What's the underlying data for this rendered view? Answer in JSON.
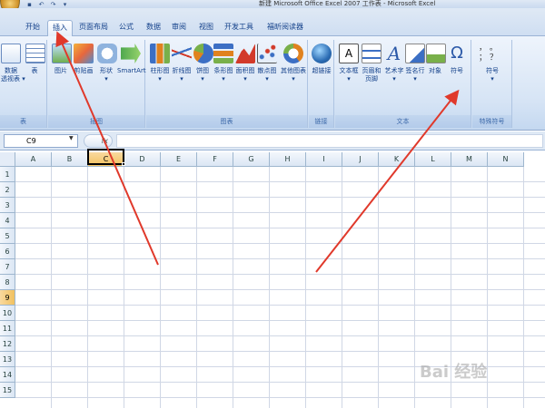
{
  "window": {
    "title": "新建 Microsoft Office Excel 2007 工作表 - Microsoft Excel"
  },
  "tabs": [
    "开始",
    "插入",
    "页面布局",
    "公式",
    "数据",
    "审阅",
    "视图",
    "开发工具",
    "福昕阅读器"
  ],
  "active_tab": "插入",
  "ribbon": {
    "groups": {
      "table": {
        "label": "表",
        "buttons": {
          "pivot": "数据\n透视表 ▾",
          "table": "表"
        }
      },
      "illustrations": {
        "label": "插图",
        "buttons": {
          "picture": "图片",
          "clipart": "剪贴画",
          "shapes": "形状\n▾",
          "smartart": "SmartArt"
        }
      },
      "charts": {
        "label": "图表",
        "buttons": {
          "column": "柱形图\n▾",
          "line": "折线图\n▾",
          "pie": "饼图\n▾",
          "bar": "条形图\n▾",
          "area": "面积图\n▾",
          "scatter": "散点图\n▾",
          "other": "其他图表\n▾"
        }
      },
      "links": {
        "label": "链接",
        "buttons": {
          "hyperlink": "超链接"
        }
      },
      "text": {
        "label": "文本",
        "buttons": {
          "textbox": "文本框\n▾",
          "headerfooter": "页眉和\n页脚",
          "wordart": "艺术字\n▾",
          "signature": "签名行\n▾",
          "object": "对象",
          "symbol": "符号"
        }
      },
      "special": {
        "label": "特殊符号",
        "buttons": {
          "symbols": "符号\n▾"
        }
      }
    }
  },
  "formula_bar": {
    "name_box": "C9",
    "fx": "fx",
    "formula": ""
  },
  "sheet": {
    "columns": [
      "A",
      "B",
      "C",
      "D",
      "E",
      "F",
      "G",
      "H",
      "I",
      "J",
      "K",
      "L",
      "M",
      "N"
    ],
    "rows": [
      "1",
      "2",
      "3",
      "4",
      "5",
      "6",
      "7",
      "8",
      "9",
      "10",
      "11",
      "12",
      "13",
      "14",
      "15"
    ],
    "selected_cell": "C9",
    "selected_column": "C",
    "selected_row": "9"
  },
  "watermark": "Bai 经验",
  "colors": {
    "accent": "#15428b",
    "arrow": "#e0392b",
    "selected_header": "#f1c15f"
  }
}
